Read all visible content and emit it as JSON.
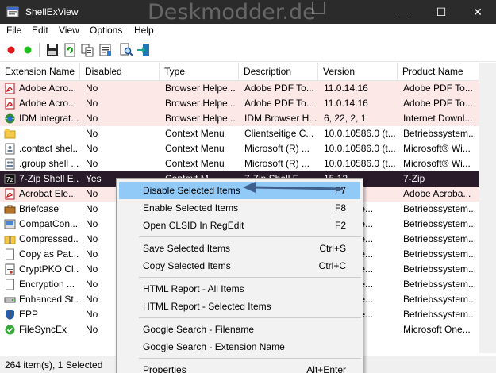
{
  "window": {
    "title": "ShellExView",
    "watermark": "Deskmodder.de",
    "controls": {
      "minimize": "—",
      "maximize": "☐",
      "close": "✕"
    }
  },
  "menu": [
    "File",
    "Edit",
    "View",
    "Options",
    "Help"
  ],
  "toolbar": [
    "red-dot-icon",
    "green-dot-icon",
    "save-icon",
    "refresh-icon",
    "copy-icon",
    "properties-icon",
    "find-icon",
    "exit-icon"
  ],
  "columns": [
    "Extension Name",
    "Disabled",
    "Type",
    "Description",
    "Version",
    "Product Name"
  ],
  "rows": [
    {
      "name": "Adobe Acro...",
      "disabled": "No",
      "type": "Browser Helpe...",
      "desc": "Adobe PDF To...",
      "version": "11.0.14.16",
      "product": "Adobe PDF To...",
      "icon": "pdf-icon",
      "style": "pink"
    },
    {
      "name": "Adobe Acro...",
      "disabled": "No",
      "type": "Browser Helpe...",
      "desc": "Adobe PDF To...",
      "version": "11.0.14.16",
      "product": "Adobe PDF To...",
      "icon": "pdf-icon",
      "style": "pink"
    },
    {
      "name": "IDM integrat...",
      "disabled": "No",
      "type": "Browser Helpe...",
      "desc": "IDM Browser H...",
      "version": "6, 22, 2, 1",
      "product": "Internet Downl...",
      "icon": "globe-icon",
      "style": "pink"
    },
    {
      "name": "",
      "disabled": "No",
      "type": "Context Menu",
      "desc": "Clientseitige C...",
      "version": "10.0.10586.0 (t...",
      "product": "Betriebssystem...",
      "icon": "folder-icon",
      "style": ""
    },
    {
      "name": ".contact shel...",
      "disabled": "No",
      "type": "Context Menu",
      "desc": "Microsoft (R) ...",
      "version": "10.0.10586.0 (t...",
      "product": "Microsoft® Wi...",
      "icon": "contact-icon",
      "style": ""
    },
    {
      "name": ".group shell ...",
      "disabled": "No",
      "type": "Context Menu",
      "desc": "Microsoft (R) ...",
      "version": "10.0.10586.0 (t...",
      "product": "Microsoft® Wi...",
      "icon": "group-icon",
      "style": ""
    },
    {
      "name": "7-Zip Shell E...",
      "disabled": "Yes",
      "type": "Context M...",
      "desc": "7-Zip Shell E...",
      "version": "15.12",
      "product": "7-Zip",
      "icon": "zip-icon",
      "style": "selected"
    },
    {
      "name": "Acrobat Ele...",
      "disabled": "No",
      "type": "",
      "desc": "",
      "version": "",
      "product": "Adobe Acroba...",
      "icon": "pdf-icon",
      "style": "pink"
    },
    {
      "name": "Briefcase",
      "disabled": "No",
      "type": "",
      "desc": "",
      "version": "6.0 (syste...",
      "product": "Betriebssystem...",
      "icon": "briefcase-icon",
      "style": ""
    },
    {
      "name": "CompatCon...",
      "disabled": "No",
      "type": "",
      "desc": "",
      "version": "6.0 (syste...",
      "product": "Betriebssystem...",
      "icon": "compat-icon",
      "style": ""
    },
    {
      "name": "Compressed...",
      "disabled": "No",
      "type": "",
      "desc": "",
      "version": "6.0 (syste...",
      "product": "Betriebssystem...",
      "icon": "zipfolder-icon",
      "style": ""
    },
    {
      "name": "Copy as Pat...",
      "disabled": "No",
      "type": "",
      "desc": "",
      "version": "6.0 (syste...",
      "product": "Betriebssystem...",
      "icon": "page-icon",
      "style": ""
    },
    {
      "name": "CryptPKO Cl...",
      "disabled": "No",
      "type": "",
      "desc": "",
      "version": "6.0 (syste...",
      "product": "Betriebssystem...",
      "icon": "cert-icon",
      "style": ""
    },
    {
      "name": "Encryption ...",
      "disabled": "No",
      "type": "",
      "desc": "",
      "version": "6.0 (syste...",
      "product": "Betriebssystem...",
      "icon": "page-icon",
      "style": ""
    },
    {
      "name": "Enhanced St...",
      "disabled": "No",
      "type": "",
      "desc": "",
      "version": "6.0 (syste...",
      "product": "Betriebssystem...",
      "icon": "drive-icon",
      "style": ""
    },
    {
      "name": "EPP",
      "disabled": "No",
      "type": "",
      "desc": "",
      "version": "6.0 (syste...",
      "product": "Betriebssystem...",
      "icon": "shield-icon",
      "style": ""
    },
    {
      "name": "FileSyncEx",
      "disabled": "No",
      "type": "",
      "desc": "",
      "version": "1019",
      "product": "Microsoft One...",
      "icon": "sync-icon",
      "style": ""
    }
  ],
  "context_menu": [
    {
      "label": "Disable Selected Items",
      "key": "F7",
      "highlight": true
    },
    {
      "label": "Enable Selected Items",
      "key": "F8"
    },
    {
      "label": "Open CLSID In RegEdit",
      "key": "F2"
    },
    {
      "sep": true
    },
    {
      "label": "Save Selected Items",
      "key": "Ctrl+S"
    },
    {
      "label": "Copy Selected Items",
      "key": "Ctrl+C"
    },
    {
      "sep": true
    },
    {
      "label": "HTML Report - All Items",
      "key": ""
    },
    {
      "label": "HTML Report - Selected Items",
      "key": ""
    },
    {
      "sep": true
    },
    {
      "label": "Google Search - Filename",
      "key": ""
    },
    {
      "label": "Google Search - Extension Name",
      "key": ""
    },
    {
      "sep": true
    },
    {
      "label": "Properties",
      "key": "Alt+Enter"
    }
  ],
  "status": "264 item(s), 1 Selected",
  "colors": {
    "titlebar": "#2b2b2b",
    "pink_row": "#fde8e8",
    "selected_row": "#2a1b2b",
    "menu_highlight": "#91c9f7",
    "arrow": "#3f5f8c"
  }
}
